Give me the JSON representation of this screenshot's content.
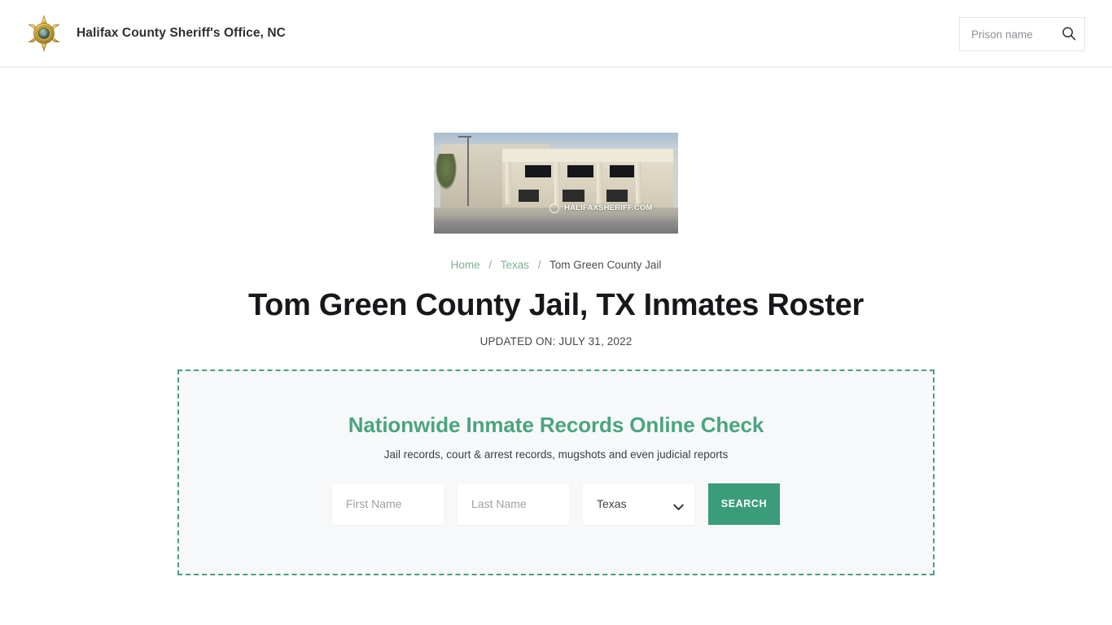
{
  "header": {
    "logo_icon": "sheriff-star-badge-icon",
    "brand_title": "Halifax County Sheriff's Office, NC",
    "search": {
      "placeholder": "Prison name",
      "value": "",
      "icon": "search-icon"
    }
  },
  "hero": {
    "image_alt": "Tom Green County Jail building",
    "watermark": "HALIFAXSHERIFF.COM"
  },
  "breadcrumb": {
    "items": [
      {
        "label": "Home",
        "link": true
      },
      {
        "label": "Texas",
        "link": true
      },
      {
        "label": "Tom Green County Jail",
        "link": false
      }
    ],
    "separator": "/"
  },
  "main": {
    "title": "Tom Green County Jail, TX Inmates Roster",
    "updated_on": "UPDATED ON: JULY 31, 2022"
  },
  "search_panel": {
    "heading": "Nationwide Inmate Records Online Check",
    "subheading": "Jail records, court & arrest records, mugshots and even judicial reports",
    "first_name": {
      "placeholder": "First Name",
      "value": ""
    },
    "last_name": {
      "placeholder": "Last Name",
      "value": ""
    },
    "state_select": {
      "selected": "Texas",
      "chevron_icon": "chevron-down-icon"
    },
    "submit_label": "SEARCH"
  },
  "colors": {
    "accent_green": "#3b9c79",
    "heading_green": "#4aa57f",
    "link_green": "#7bb38f",
    "dashed_border": "#4a9d7d",
    "panel_bg": "#f6f8f9",
    "page_bg": "#ffffff",
    "title_text": "#17181b"
  }
}
